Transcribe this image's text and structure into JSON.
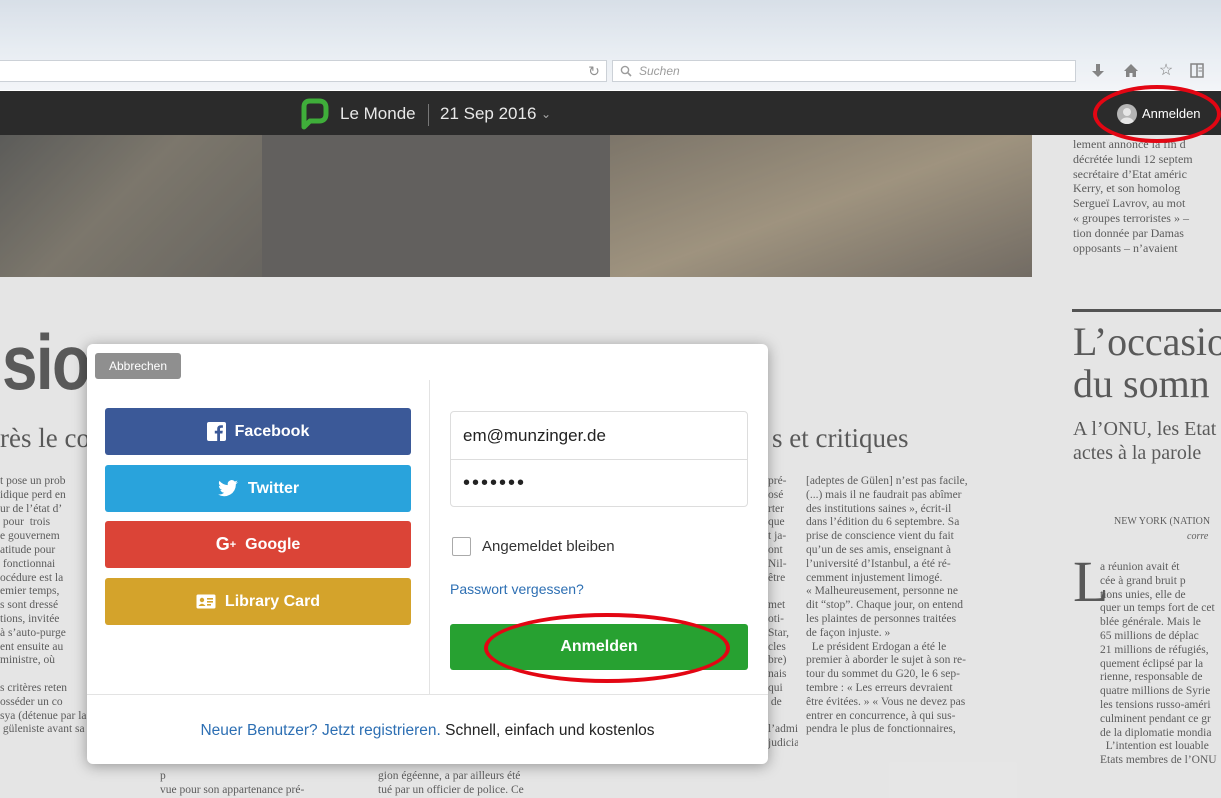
{
  "browser": {
    "search_placeholder": "Suchen",
    "icons": [
      "reload-icon",
      "search-icon",
      "download-icon",
      "home-icon",
      "star-icon",
      "reading-list-icon"
    ]
  },
  "reader": {
    "publication": "Le Monde",
    "date": "21 Sep 2016",
    "signin_label": "Anmelden",
    "accent_color": "#27a131"
  },
  "article": {
    "headline_fragment": "sion",
    "subhead_fragment_left": "rès le co",
    "subhead_fragment_right": "s et critiques",
    "right_headline_1": "L’occasio",
    "right_headline_2": "du somn",
    "right_subhead_1": "A l’ONU, les Etat",
    "right_subhead_2": "actes à la parole",
    "dateline": "NEW YORK (NATION",
    "correspondent": "corre",
    "drop_cap": "L"
  },
  "columns": {
    "col_top_right": "lement annoncé la fin d\ndécrétée lundi 12 septem\nsecrétaire d’Etat améric\nKerry, et son homolog\nSergueï Lavrov, au mot\n« groupes terroristes » –\ntion donnée par Damas\nopposants – n’avaient",
    "col_a": "t pose un prob\nidique perd en\nur de l’état d’\n pour  trois\ne gouvernem\natitude pour\n fonctionnai\nocédure est la\nemier temps,\ns sont dressé\ntions, invitée\nà s’auto-purge\nent ensuite au\nministre, où\n\ns critères reten\nosséder un co\nsya (détenue par la\n güleniste avant sa",
    "col_b_bottom": "p\nvue pour son appartenance pré-\nsumée à « l’organisation terro-",
    "col_c_bottom": "gion égéenne, a par ailleurs été\ntué par un officier de police. Ce",
    "col_d_fragments": "pré-\nosé\nrter\nque\nt ja-\nont\nNil-\nêtre\n\nmet\noti-\nStar,\ncles\nbre)\nnais\nqui\n de\n\nl’administration et de l’appareil\njudiciaire, quand les responsables",
    "col_e": "[adeptes de Gülen] n’est pas facile,\n(...) mais il ne faudrait pas abîmer\ndes institutions saines », écrit-il\ndans l’édition du 6 septembre. Sa\nprise de conscience vient du fait\nqu’un de ses amis, enseignant à\nl’université d’Istanbul, a été ré-\ncemment injustement limogé.\n« Malheureusement, personne ne\ndit “stop”. Chaque jour, on entend\nles plaintes de personnes traitées\nde façon injuste. »\n  Le président Erdogan a été le\npremier à aborder le sujet à son re-\ntour du sommet du G20, le 6 sep-\ntembre : « Les erreurs devraient\nêtre évitées. » « Vous ne devez pas\nentrer en concurrence, à qui sus-\npendra le plus de fonctionnaires,",
    "col_f": "a réunion avait ét\ncée à grand bruit p\ntions unies, elle de\nquer un temps fort de cet\nblée générale. Mais le\n65 millions de déplac\n21 millions de réfugiés,\nquement éclipsé par la\nrienne, responsable de\nquatre millions de Syrie\nles tensions russo-améri\nculminent pendant ce gr\nde la diplomatie mondia\n  L’intention est louable\nEtats membres de l’ONU"
  },
  "login_dialog": {
    "cancel_label": "Abbrechen",
    "social": [
      {
        "label": "Facebook",
        "icon": "facebook-icon",
        "color": "#3b5998"
      },
      {
        "label": "Twitter",
        "icon": "twitter-bird-icon",
        "color": "#29a3dc"
      },
      {
        "label": "Google",
        "icon": "google-plus-icon",
        "color": "#db4437"
      },
      {
        "label": "Library Card",
        "icon": "library-card-icon",
        "color": "#d4a32b"
      }
    ],
    "email_value": "em@munzinger.de",
    "password_value": "•••••••",
    "remember_label": "Angemeldet bleiben",
    "remember_checked": false,
    "forgot_label": "Passwort vergessen?",
    "submit_label": "Anmelden",
    "register_link": "Neuer Benutzer? Jetzt registrieren.",
    "register_tagline": " Schnell, einfach und kostenlos"
  }
}
